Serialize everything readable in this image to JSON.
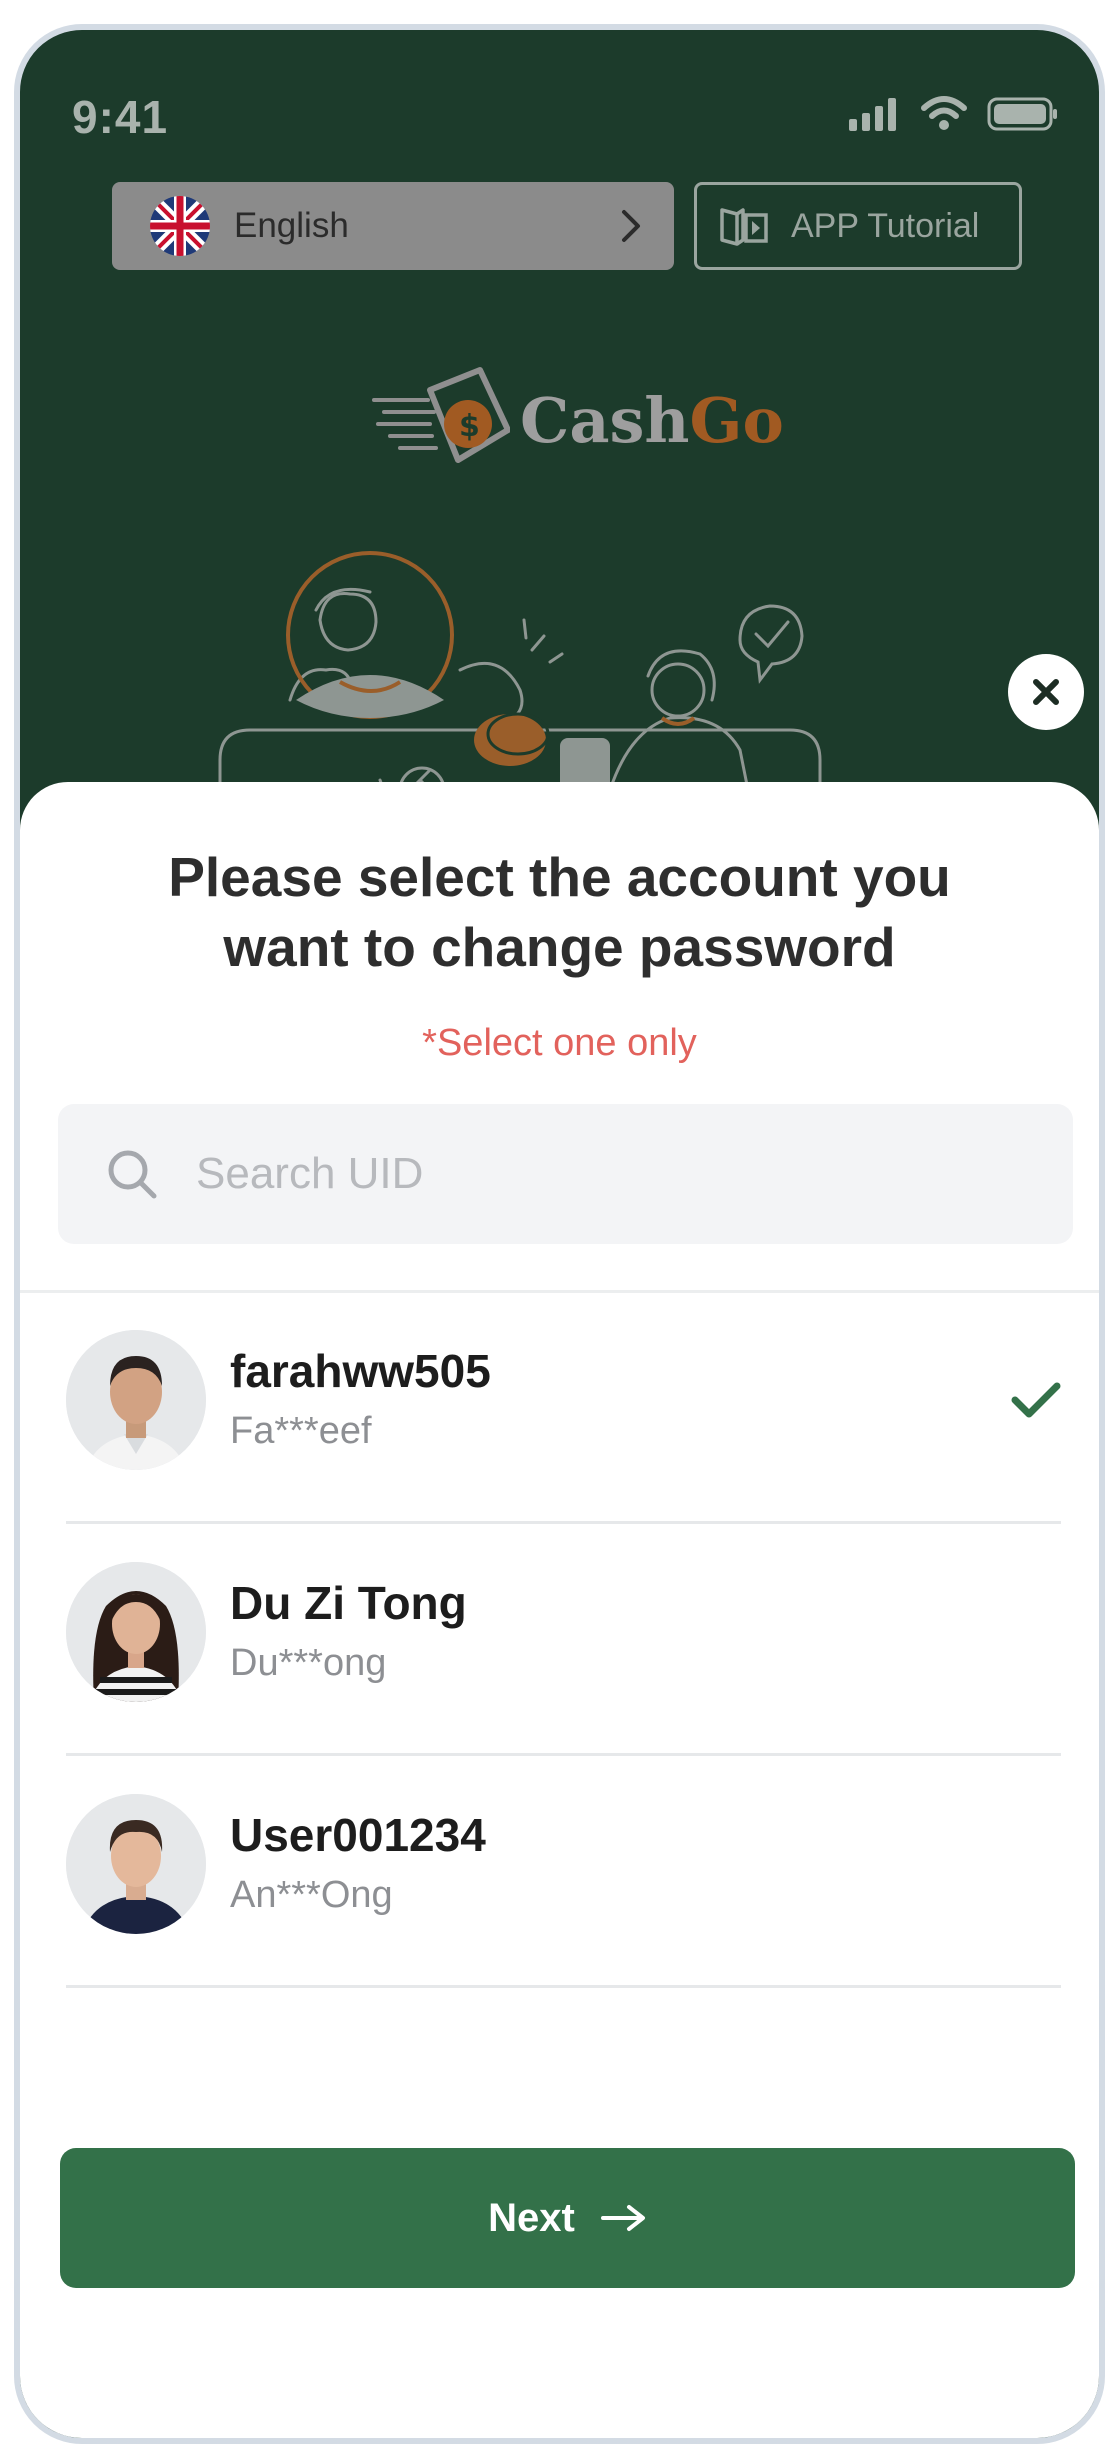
{
  "status_bar": {
    "time": "9:41"
  },
  "header": {
    "language_label": "English",
    "tutorial_label": "APP Tutorial"
  },
  "brand": {
    "name_part1": "Cash",
    "name_part2": "Go",
    "accent": "#a15a22"
  },
  "sheet": {
    "title_line1": "Please select the account you",
    "title_line2": "want to change password",
    "hint": "*Select one only",
    "search_placeholder": "Search UID",
    "next_label": "Next"
  },
  "accounts": [
    {
      "name": "farahww505",
      "masked": "Fa***eef",
      "selected": true
    },
    {
      "name": "Du Zi Tong",
      "masked": "Du***ong",
      "selected": false
    },
    {
      "name": "User001234",
      "masked": "An***Ong",
      "selected": false
    }
  ],
  "colors": {
    "background": "#1c3b2b",
    "primary": "#337149",
    "hint": "#e2625c"
  },
  "icons": [
    "signal-icon",
    "wifi-icon",
    "battery-icon",
    "uk-flag-icon",
    "chevron-right-icon",
    "book-icon",
    "close-icon",
    "search-icon",
    "check-icon",
    "arrow-right-icon"
  ]
}
